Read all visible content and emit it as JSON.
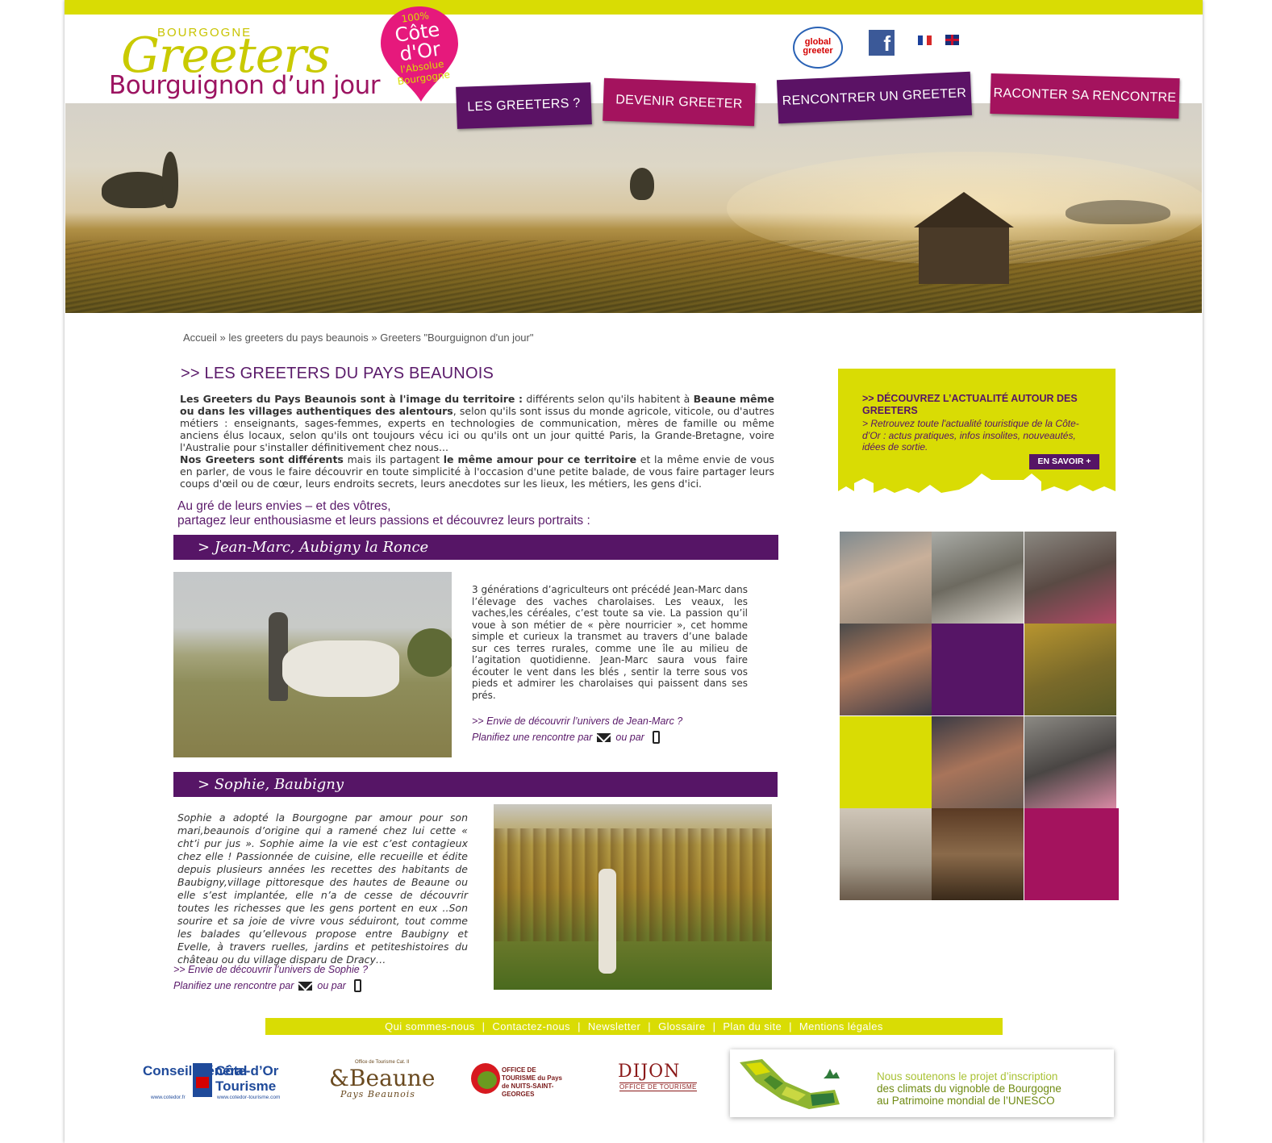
{
  "header": {
    "logo_region": "BOURGOGNE",
    "logo_title": "Greeters",
    "logo_subtitle": "Bourguignon d’un jour",
    "badge_percent": "100%",
    "badge_place": "Côte d'Or",
    "badge_slogan": "l'Absolue Bourgogne",
    "global_greeter": "global greeter",
    "facebook_label": "f",
    "nav": [
      "LES GREETERS ?",
      "DEVENIR GREETER",
      "RENCONTRER UN GREETER",
      "RACONTER SA RENCONTRE"
    ]
  },
  "breadcrumb": "Accueil » les greeters du pays beaunois » Greeters \"Bourguignon d'un jour\"",
  "page_title": ">> LES GREETERS DU PAYS BEAUNOIS",
  "intro": {
    "p1_bold_a": "Les Greeters du Pays Beaunois sont à l'image du territoire :",
    "p1_text_a": " différents selon qu'ils habitent à ",
    "p1_bold_b": "Beaune même ou dans les villages authentiques des alentours",
    "p1_text_b": ", selon qu'ils sont issus du monde agricole, viticole, ou d'autres métiers : enseignants, sages-femmes, experts en technologies de communication, mères de famille ou même anciens élus locaux, selon qu'ils ont toujours vécu ici ou qu'ils ont un jour quitté Paris, la Grande-Bretagne, voire l'Australie pour s'installer définitivement chez nous...",
    "p2_bold_a": "Nos Greeters sont différents",
    "p2_text_a": " mais ils partagent ",
    "p2_bold_b": "le même amour pour ce territoire",
    "p2_text_b": " et la même envie de vous en parler, de vous le faire découvrir en toute simplicité à l'occasion d'une petite balade, de vous faire partager leurs coups d'œil ou de cœur, leurs endroits secrets, leurs anecdotes sur les lieux, les métiers, les gens d'ici."
  },
  "invite": {
    "line1": "Au gré de leurs envies – et des vôtres,",
    "line2": "partagez leur enthousiasme et leurs passions et  découvrez leurs portraits :"
  },
  "greeters": [
    {
      "title": "> Jean-Marc, Aubigny la Ronce",
      "description": "3 générations d’agriculteurs ont précédé Jean-Marc dans l’élevage des vaches charolaises. Les veaux, les vaches,les céréales, c’est toute sa vie. La passion qu’il voue à son métier de « père nourricier », cet homme simple et curieux la transmet au travers d’une balade sur ces terres rurales, comme une île au milieu de l’agitation quotidienne. Jean-Marc  saura vous faire écouter le vent dans les blés , sentir la terre sous vos pieds et admirer les charolaises qui paissent dans ses prés.",
      "cta": ">> Envie de découvrir l’univers de Jean-Marc ?",
      "plan": "Planifiez une rencontre par",
      "or": "ou par"
    },
    {
      "title": "> Sophie, Baubigny",
      "description": "Sophie a adopté la Bourgogne par amour pour son mari,beaunois d’origine qui a ramené chez lui cette « cht’i pur jus ». Sophie aime la vie est c’est contagieux chez elle ! Passionnée de cuisine, elle recueille et édite depuis plusieurs années les recettes des habitants de Baubigny,village pittoresque des hautes de Beaune ou elle s’est implantée, elle n’a de cesse de découvrir toutes les richesses que les gens portent en eux ..Son sourire et sa joie de vivre vous séduiront, tout comme les balades qu’ellevous propose entre Baubigny et Evelle, à travers ruelles, jardins et petiteshistoires du château ou du village disparu de Dracy…",
      "cta": ">> Envie de découvrir l’univers de Sophie ?",
      "plan": "Planifiez une rencontre par",
      "or": "ou par"
    }
  ],
  "news": {
    "title": ">> DÉCOUVREZ L’ACTUALITÉ AUTOUR DES GREETERS",
    "text": "> Retrouvez toute l'actualité touristique de la Côte-d’Or : actus pratiques, infos insolites, nouveautés, idées de sortie.",
    "button": "EN SAVOIR +"
  },
  "footer": {
    "links": [
      "Qui sommes-nous",
      "Contactez-nous",
      "Newsletter",
      "Glossaire",
      "Plan du site",
      "Mentions légales"
    ],
    "separator": "|"
  },
  "partners": {
    "cg_left": "Conseil Général",
    "cg_right": "Côte-d’Or Tourisme",
    "cg_url1": "www.cotedor.fr",
    "cg_url2": "www.cotedor-tourisme.com",
    "beaune_small": "Office de Tourisme Cat. II",
    "beaune_title": "&Beaune",
    "beaune_sub": "Pays Beaunois",
    "nsg_text": "OFFICE DE TOURISME du Pays de NUITS-SAINT-GEORGES",
    "dijon_title": "DIJON",
    "dijon_sub": "OFFICE DE TOURISME",
    "unesco_l1": "Nous soutenons le projet d’inscription",
    "unesco_l2": "des climats du vignoble de Bourgogne",
    "unesco_l3": "au Patrimoine mondial de l’UNESCO"
  },
  "colors": {
    "lime": "#d9dc04",
    "purple": "#561566",
    "magenta": "#a4135e"
  }
}
